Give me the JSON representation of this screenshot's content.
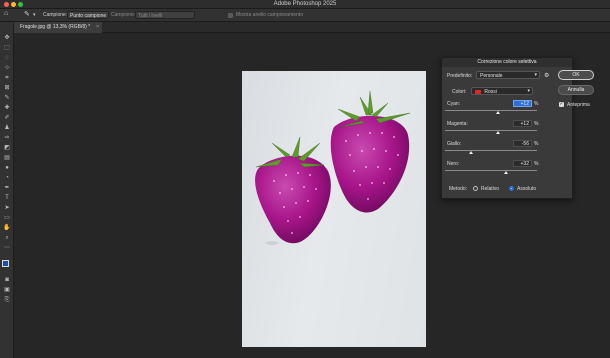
{
  "app": {
    "title": "Adobe Photoshop 2025"
  },
  "options_bar": {
    "sample_label": "Campione:",
    "sample_value": "Punto campione",
    "sample2_label": "Campione:",
    "sample2_value": "Tutti i livelli",
    "hint": "Mostra anello campionamento"
  },
  "tab": {
    "label": "Fragole.jpg @ 13,3% (RGB/8) *"
  },
  "dialog": {
    "title": "Correzione colore selettiva",
    "preset_label": "Predefinito:",
    "preset_value": "Personale",
    "colors_label": "Colori:",
    "colors_value": "Rossi",
    "colors_swatch": "#e0262a",
    "sliders": [
      {
        "label": "Cyan:",
        "value": "+12",
        "percent": "%",
        "setting": 12
      },
      {
        "label": "Magenta:",
        "value": "+12",
        "percent": "%",
        "setting": 12
      },
      {
        "label": "Giallo:",
        "value": "-56",
        "percent": "%",
        "setting": -56
      },
      {
        "label": "Nero:",
        "value": "+32",
        "percent": "%",
        "setting": 32
      }
    ],
    "method_label": "Metodo:",
    "method_relative": "Relativo",
    "method_absolute": "Assoluto",
    "ok_label": "OK",
    "cancel_label": "Annulla",
    "preview_label": "Anteprima"
  },
  "colors": {
    "accent": "#2f6fd1",
    "fruit": "#b3178f",
    "leaf": "#5f9a2f"
  }
}
